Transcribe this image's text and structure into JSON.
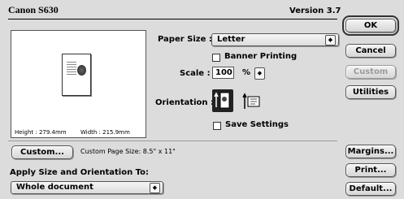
{
  "dialog": {
    "printer_name": "Canon S630",
    "version": "Version 3.7"
  },
  "preview": {
    "height_label": "Height : 279.4mm",
    "width_label": "Width : 215.9mm"
  },
  "form": {
    "paper_size_label": "Paper Size :",
    "paper_size_value": "Letter",
    "banner_label": "Banner Printing",
    "scale_label": "Scale :",
    "scale_value": "100",
    "scale_unit": "%",
    "orientation_label": "Orientation :",
    "save_settings_label": "Save Settings"
  },
  "custom": {
    "button_label": "Custom...",
    "page_size_text": "Custom Page Size: 8.5\" x 11\""
  },
  "apply": {
    "label": "Apply Size and Orientation To:",
    "value": "Whole document"
  },
  "buttons": {
    "ok": "OK",
    "cancel": "Cancel",
    "custom_disabled": "Custom",
    "utilities": "Utilities",
    "margins": "Margins...",
    "print": "Print...",
    "default": "Default..."
  }
}
